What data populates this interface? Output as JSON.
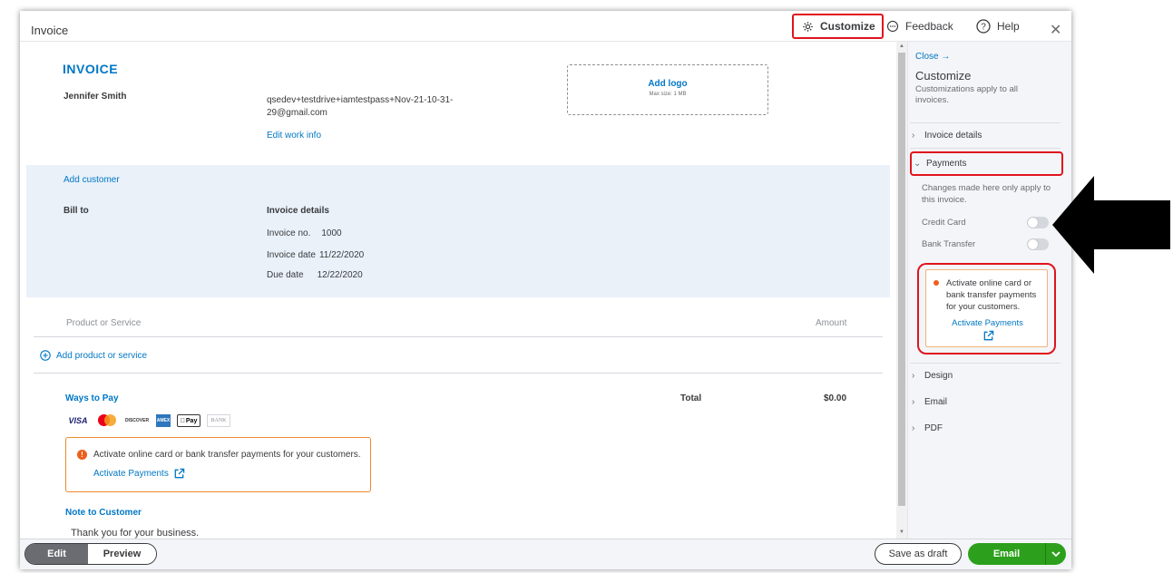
{
  "header": {
    "title": "Invoice",
    "customize_label": "Customize",
    "feedback_label": "Feedback",
    "help_label": "Help",
    "close_glyph": "✕"
  },
  "invoice": {
    "heading": "INVOICE",
    "company_name": "Jennifer Smith",
    "email": "qsedev+testdrive+iamtestpass+Nov-21-10-31-29@gmail.com",
    "edit_work_info": "Edit work info",
    "add_logo": "Add logo",
    "logo_max": "Max size: 1 MB",
    "add_customer": "Add customer",
    "bill_to": "Bill to",
    "details_title": "Invoice details",
    "invoice_no_label": "Invoice no.",
    "invoice_no": "1000",
    "invoice_date_label": "Invoice date",
    "invoice_date": "11/22/2020",
    "due_date_label": "Due date",
    "due_date": "12/22/2020",
    "col_product": "Product or Service",
    "col_amount": "Amount",
    "add_product": "Add product or service",
    "ways_to_pay": "Ways to Pay",
    "total_label": "Total",
    "total_value": "$0.00",
    "pay_icons": [
      "VISA",
      "mastercard",
      "DISCOVER",
      "AMEX",
      "Pay",
      "BANK"
    ],
    "warning_text": "Activate online card or bank transfer payments for your customers.",
    "activate_payments": "Activate Payments",
    "note_label": "Note to Customer",
    "note_value": "Thank you for your business."
  },
  "panel": {
    "close": "Close →",
    "title": "Customize",
    "subtitle": "Customizations apply to all invoices.",
    "sections": {
      "invoice_details": "Invoice details",
      "payments": "Payments",
      "design": "Design",
      "email": "Email",
      "pdf": "PDF"
    },
    "payments_note": "Changes made here only apply to this invoice.",
    "credit_card": "Credit Card",
    "bank_transfer": "Bank Transfer",
    "activate_text": "Activate online card or bank transfer payments for your customers.",
    "activate_link": "Activate Payments"
  },
  "footer": {
    "edit": "Edit",
    "preview": "Preview",
    "save_draft": "Save as draft",
    "email": "Email"
  },
  "colors": {
    "accent_blue": "#0077c5",
    "green": "#2ca01c",
    "highlight_red": "#e0141e",
    "warning_orange": "#ec5f1b"
  },
  "icons": [
    "gear-icon",
    "feedback-bubble-icon",
    "help-circle-icon",
    "close-icon",
    "plus-circle-icon",
    "external-link-icon",
    "chevron-right-icon",
    "chevron-down-icon",
    "info-dot-icon"
  ]
}
